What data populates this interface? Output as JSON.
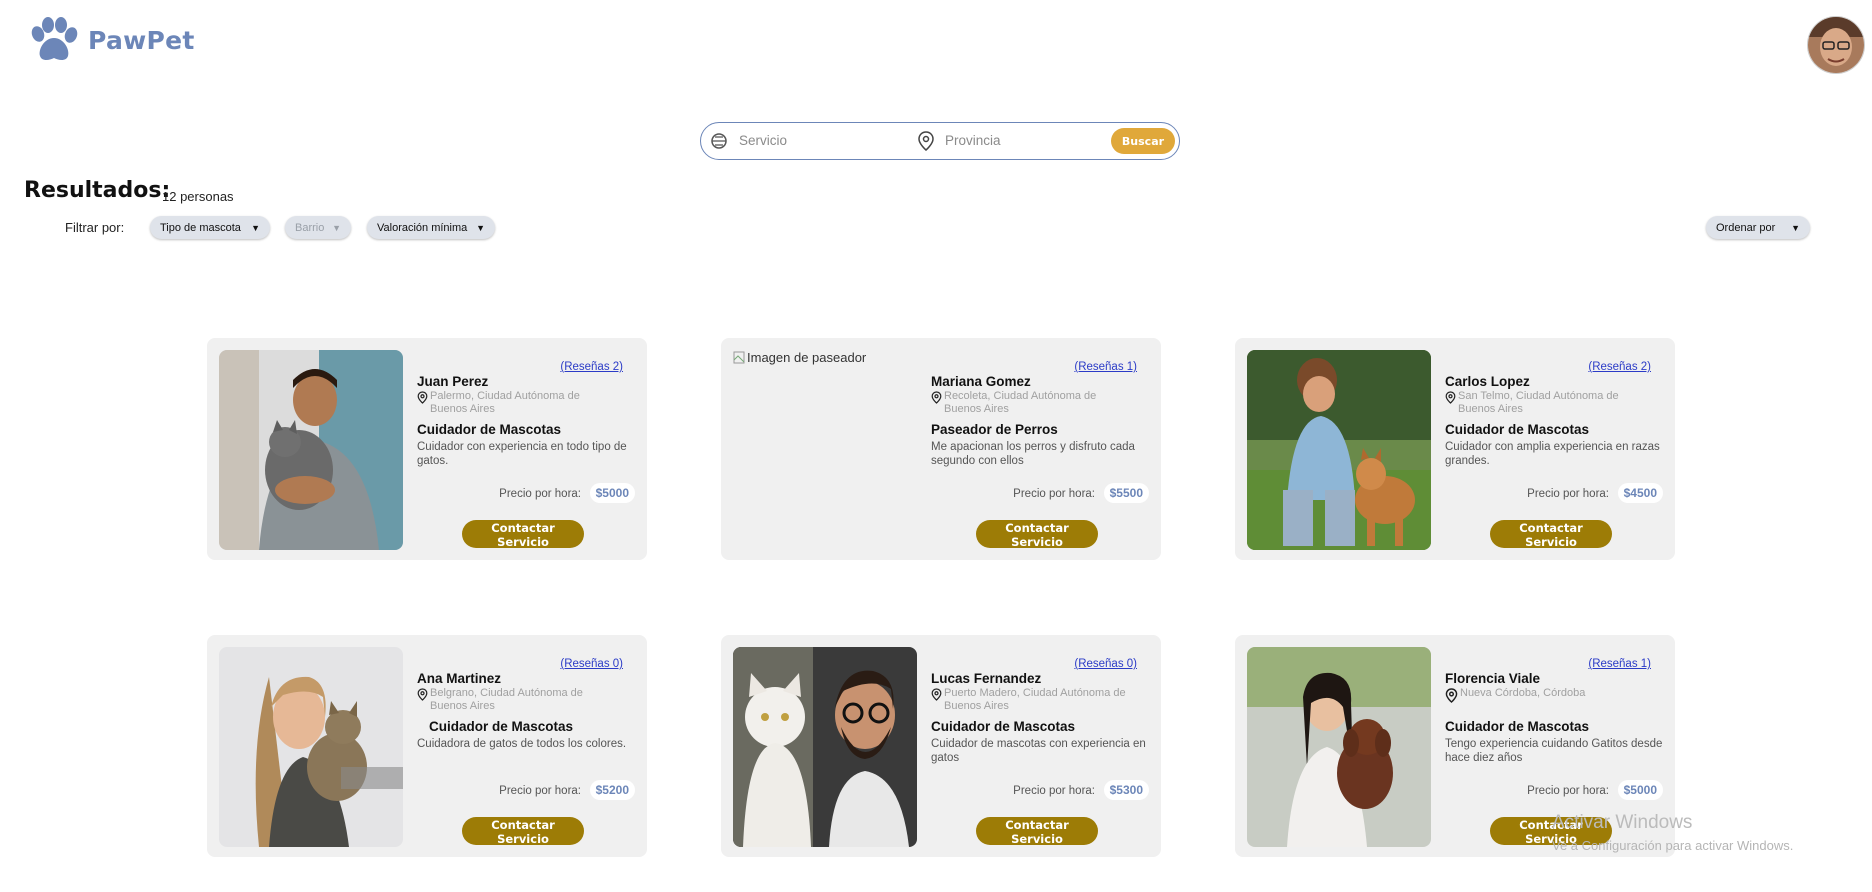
{
  "header": {
    "logo_text": "PawPet",
    "logo_icon": "paw-icon",
    "avatar_icon": "user-avatar"
  },
  "search": {
    "service_placeholder": "Servicio",
    "province_placeholder": "Provincia",
    "button_label": "Buscar"
  },
  "results": {
    "title": "Resultados:",
    "count": "12 personas"
  },
  "filters": {
    "label": "Filtrar por:",
    "pet_type": "Tipo de mascota",
    "barrio": "Barrio",
    "rating": "Valoración mínima",
    "sort": "Ordenar por"
  },
  "cards": [
    {
      "name": "Juan Perez",
      "location": "Palermo, Ciudad Autónoma de Buenos Aires",
      "role": "Cuidador de Mascotas",
      "description": "Cuidador con experiencia en todo tipo de gatos.",
      "price_label": "Precio por hora:",
      "price": "$5000",
      "reviews": "(Reseñas 2)",
      "contact": "Contactar Servicio"
    },
    {
      "name": "Mariana Gomez",
      "location": "Recoleta, Ciudad Autónoma de Buenos Aires",
      "role": "Paseador de Perros",
      "description": "Me apacionan los perros y disfruto cada segundo con ellos",
      "price_label": "Precio por hora:",
      "price": "$5500",
      "reviews": "(Reseñas 1)",
      "contact": "Contactar Servicio",
      "image_alt": "Imagen de paseador"
    },
    {
      "name": "Carlos Lopez",
      "location": "San Telmo, Ciudad Autónoma de Buenos Aires",
      "role": "Cuidador de Mascotas",
      "description": "Cuidador con amplia experiencia en razas grandes.",
      "price_label": "Precio por hora:",
      "price": "$4500",
      "reviews": "(Reseñas 2)",
      "contact": "Contactar Servicio"
    },
    {
      "name": "Ana Martinez",
      "location": "Belgrano, Ciudad Autónoma de Buenos Aires",
      "role": "Cuidador de Mascotas",
      "description": "Cuidadora de gatos de todos los colores.",
      "price_label": "Precio por hora:",
      "price": "$5200",
      "reviews": "(Reseñas 0)",
      "contact": "Contactar Servicio"
    },
    {
      "name": "Lucas Fernandez",
      "location": "Puerto Madero, Ciudad Autónoma de Buenos Aires",
      "role": "Cuidador de Mascotas",
      "description": "Cuidador de mascotas con experiencia en gatos",
      "price_label": "Precio por hora:",
      "price": "$5300",
      "reviews": "(Reseñas 0)",
      "contact": "Contactar Servicio"
    },
    {
      "name": "Florencia Viale",
      "location": "Nueva Córdoba, Córdoba",
      "role": "Cuidador de Mascotas",
      "description": "Tengo experiencia cuidando Gatitos desde hace diez años",
      "price_label": "Precio por hora:",
      "price": "$5000",
      "reviews": "(Reseñas 1)",
      "contact": "Contactar Servicio"
    }
  ],
  "watermark": {
    "title": "Activar Windows",
    "subtitle": "Ve a Configuración para activar Windows."
  },
  "colors": {
    "brand": "#6c86b8",
    "search_button": "#e0a83a",
    "contact_button": "#9d7c06",
    "card_bg": "#f0f0f0"
  }
}
